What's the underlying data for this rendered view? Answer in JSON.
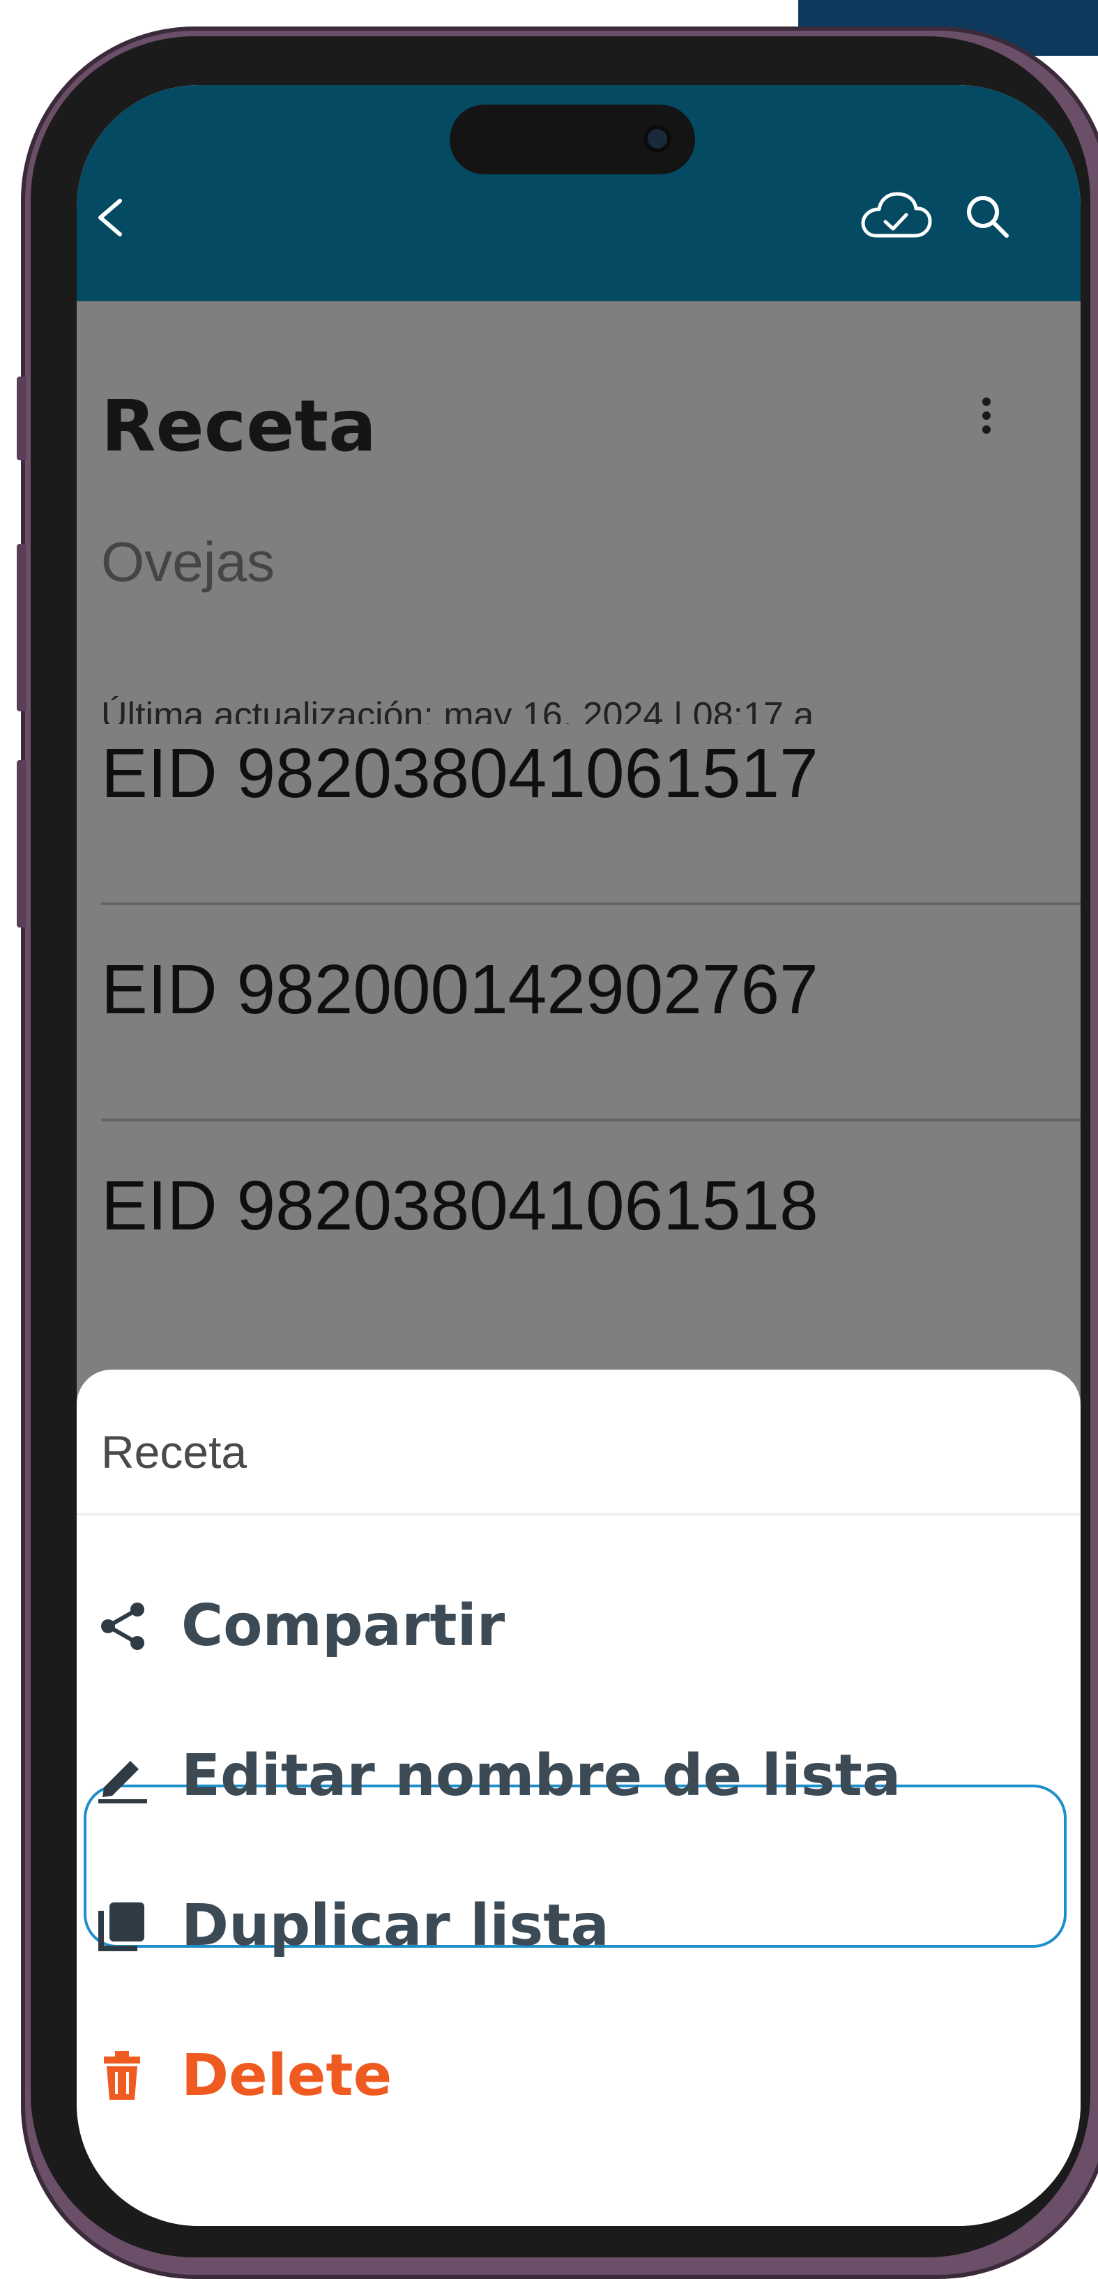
{
  "app": {
    "title": "Receta",
    "subtitle": "Ovejas",
    "last_updated": "Última actualización: may 16, 2024 | 08:17 a"
  },
  "header": {
    "back_icon": "chevron-left-icon",
    "sync_icon": "cloud-check-icon",
    "search_icon": "search-icon",
    "color": "#054a63"
  },
  "list": {
    "items": [
      {
        "label": "EID 982038041061517"
      },
      {
        "label": "EID 982000142902767"
      },
      {
        "label": "EID 982038041061518"
      }
    ]
  },
  "sheet": {
    "title": "Receta",
    "items": [
      {
        "label": "Compartir",
        "icon": "share-icon"
      },
      {
        "label": "Editar nombre de lista",
        "icon": "pencil-icon"
      },
      {
        "label": "Duplicar lista",
        "icon": "copy-icon"
      },
      {
        "label": "Delete",
        "icon": "trash-icon",
        "color": "#ef5a20"
      }
    ],
    "highlight_color": "#1f8fcb"
  }
}
